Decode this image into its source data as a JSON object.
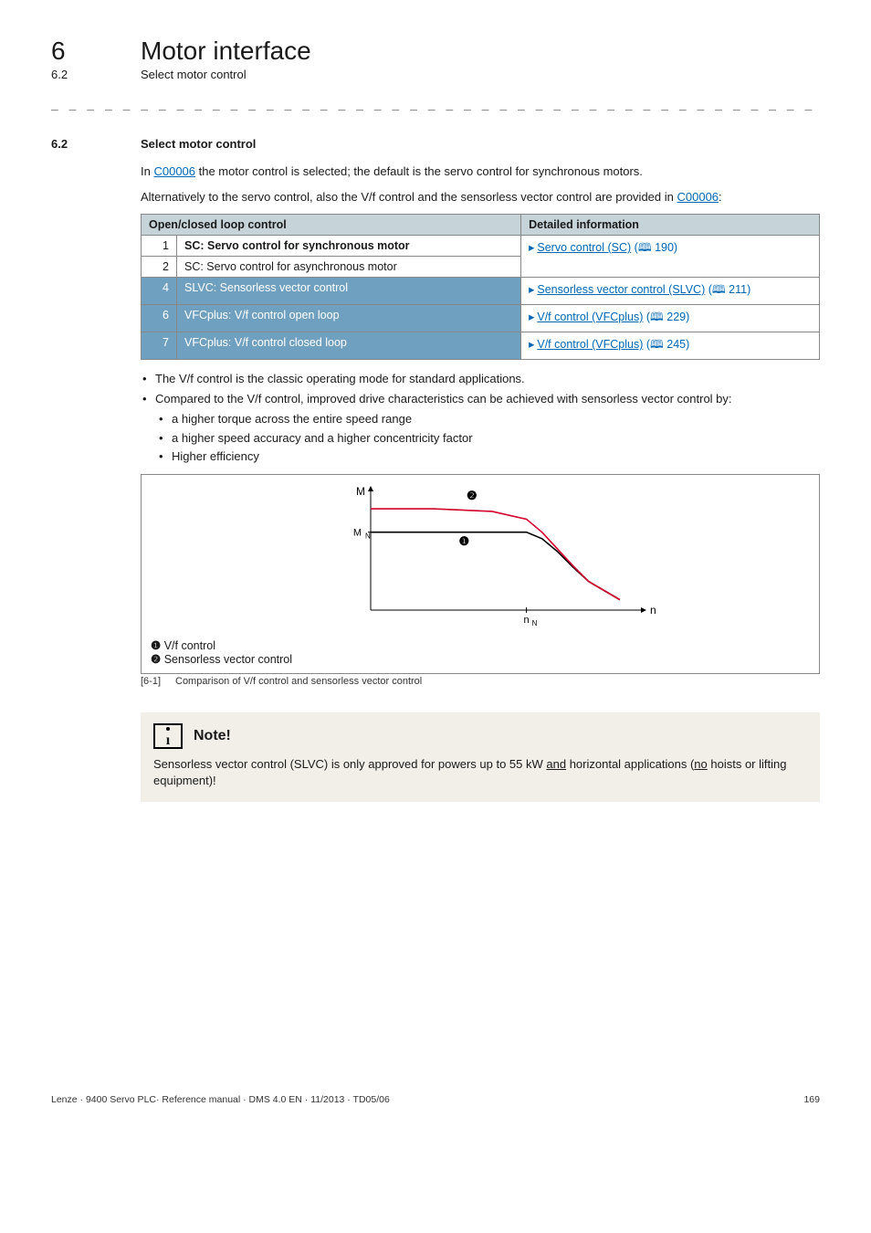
{
  "header": {
    "chapter_num": "6",
    "chapter_title": "Motor interface",
    "sub_num": "6.2",
    "sub_title": "Select motor control"
  },
  "section": {
    "num": "6.2",
    "title": "Select motor control"
  },
  "paragraphs": {
    "p1_a": "In ",
    "p1_link": "C00006",
    "p1_b": " the motor control is selected; the default is the servo control for synchronous motors.",
    "p2_a": "Alternatively to the servo control, also the V/f control and the sensorless vector control are provided in ",
    "p2_link": "C00006",
    "p2_b": ":"
  },
  "table": {
    "h1": "Open/closed loop control",
    "h2": "Detailed information",
    "rows": [
      {
        "n": "1",
        "label": "SC: Servo control for synchronous motor",
        "ref_text": "Servo control (SC)",
        "ref_page": "190"
      },
      {
        "n": "2",
        "label": "SC: Servo control for asynchronous motor"
      },
      {
        "n": "4",
        "label": "SLVC: Sensorless vector control",
        "ref_text": "Sensorless vector control (SLVC)",
        "ref_page": "211"
      },
      {
        "n": "6",
        "label": "VFCplus: V/f control open loop",
        "ref_text": "V/f control (VFCplus)",
        "ref_page": "229"
      },
      {
        "n": "7",
        "label": "VFCplus: V/f control closed loop",
        "ref_text": "V/f control (VFCplus)",
        "ref_page": "245"
      }
    ]
  },
  "bullets": {
    "b1": "The V/f control is the classic operating mode for standard applications.",
    "b2": "Compared to the V/f control, improved drive characteristics can be achieved with sensorless vector control by:",
    "sb1": "a higher torque across the entire speed range",
    "sb2": "a higher speed accuracy and a higher concentricity factor",
    "sb3": "Higher efficiency"
  },
  "chart_data": {
    "type": "line",
    "title": "",
    "xlabel": "n",
    "ylabel": "M",
    "x_tick": "n_N",
    "y_tick": "M_N",
    "series": [
      {
        "name": "V/f control",
        "color": "#000000",
        "x": [
          0,
          40,
          78,
          100,
          110,
          120,
          130,
          140,
          160
        ],
        "y": [
          60,
          60,
          60,
          60,
          55,
          45,
          33,
          22,
          8
        ]
      },
      {
        "name": "Sensorless vector control",
        "color": "#d3002c",
        "x": [
          0,
          40,
          78,
          100,
          110,
          120,
          130,
          140,
          160
        ],
        "y": [
          78,
          78,
          76,
          70,
          60,
          47,
          34,
          22,
          8
        ]
      }
    ],
    "xlim": [
      0,
      170
    ],
    "ylim": [
      0,
      90
    ],
    "markers": [
      {
        "label": "❶",
        "x": 60,
        "y": 50
      },
      {
        "label": "❷",
        "x": 65,
        "y": 85
      }
    ]
  },
  "chartlegend": {
    "l1_num": "❶",
    "l1_text": "V/f control",
    "l2_num": "❷",
    "l2_text": "Sensorless vector control"
  },
  "fig": {
    "num": "[6-1]",
    "caption": "Comparison of V/f control and sensorless vector control"
  },
  "note": {
    "title": "Note!",
    "text_a": "Sensorless vector control (SLVC) is only approved for powers up to 55 kW ",
    "text_u1": "and",
    "text_b": " horizontal applications (",
    "text_u2": "no",
    "text_c": " hoists or lifting equipment)!"
  },
  "footer": {
    "left": "Lenze · 9400 Servo PLC· Reference manual · DMS 4.0 EN · 11/2013 · TD05/06",
    "right": "169"
  }
}
